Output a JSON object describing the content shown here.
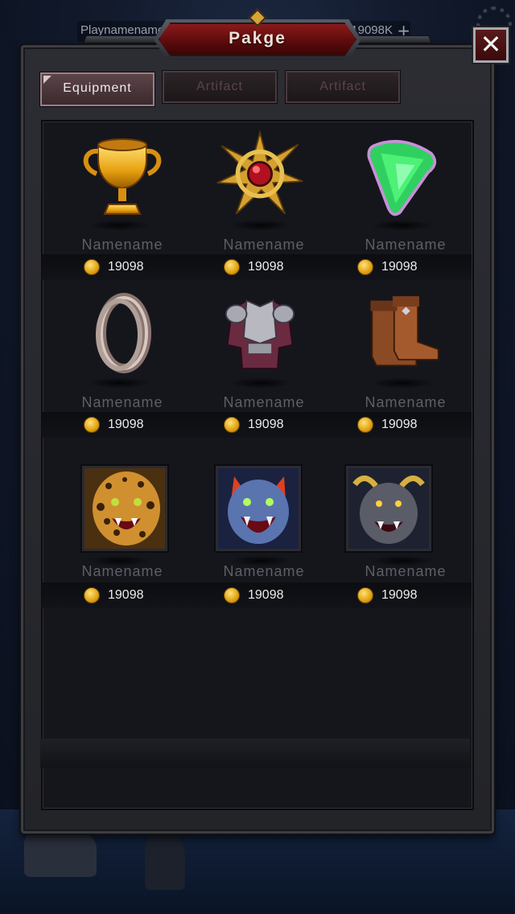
{
  "hud": {
    "player_name": "Playnamename",
    "gold": "19098K",
    "plus": "+"
  },
  "panel": {
    "title": "Pakge",
    "close": "✕"
  },
  "tabs": [
    {
      "label": "Equipment",
      "active": true
    },
    {
      "label": "Artifact",
      "active": false
    },
    {
      "label": "Artifact",
      "active": false
    }
  ],
  "items": [
    {
      "name": "Namename",
      "price": "19098",
      "icon": "gold-trophy-icon"
    },
    {
      "name": "Namename",
      "price": "19098",
      "icon": "red-gem-star-amulet-icon"
    },
    {
      "name": "Namename",
      "price": "19098",
      "icon": "green-crystal-icon"
    },
    {
      "name": "Namename",
      "price": "19098",
      "icon": "silver-ring-icon"
    },
    {
      "name": "Namename",
      "price": "19098",
      "icon": "chest-armor-icon"
    },
    {
      "name": "Namename",
      "price": "19098",
      "icon": "leather-boots-icon"
    },
    {
      "name": "Namename",
      "price": "19098",
      "icon": "leopard-portrait"
    },
    {
      "name": "Namename",
      "price": "19098",
      "icon": "werewolf-portrait"
    },
    {
      "name": "Namename",
      "price": "19098",
      "icon": "minotaur-portrait"
    }
  ],
  "colors": {
    "banner_red": "#7a1416",
    "coin_gold": "#e0a010",
    "active_tab": "#5c4448"
  }
}
